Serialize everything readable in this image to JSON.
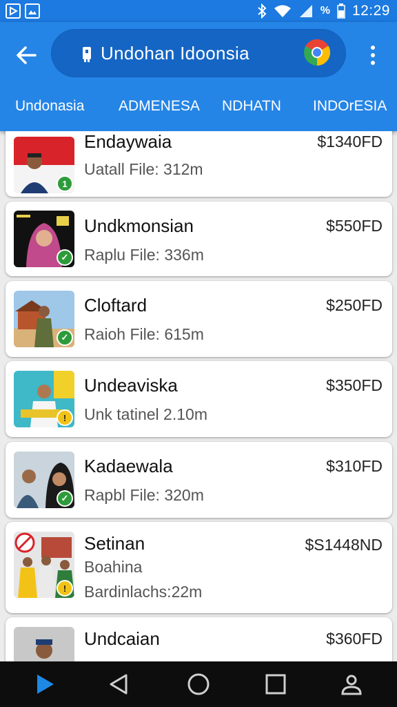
{
  "status_bar": {
    "battery": "%",
    "time": "12:29",
    "icons": [
      "play-store-icon",
      "photo-icon",
      "bluetooth-icon",
      "wifi-icon",
      "signal-icon",
      "battery-icon"
    ]
  },
  "browser": {
    "url": "Undohan Idoonsia",
    "icons": [
      "back-arrow-icon",
      "lock-icon",
      "chrome-icon",
      "more-vert-icon"
    ]
  },
  "tabs": [
    {
      "label": "Undonasia"
    },
    {
      "label": "ADMENESA"
    },
    {
      "label": "NDHATN"
    },
    {
      "label": "INDOrESIA"
    }
  ],
  "listings": [
    {
      "title": "Endaywaia",
      "subtitle": "Uatall File: 312m",
      "price": "$1340FD",
      "badge": "1"
    },
    {
      "title": "Undkmonsian",
      "subtitle": "Raplu File: 336m",
      "price": "$550FD",
      "badge": "✓"
    },
    {
      "title": "Cloftard",
      "subtitle": "Raioh File: 615m",
      "price": "$250FD",
      "badge": "✓"
    },
    {
      "title": "Undeaviska",
      "subtitle": "Unk tatinel 2.10m",
      "price": "$350FD",
      "badge": "!"
    },
    {
      "title": "Kadaewala",
      "subtitle": "Rapbl File: 320m",
      "price": "$310FD",
      "badge": "✓"
    },
    {
      "title": "Setinan",
      "subtitle": "Boahina",
      "subtitle2": "Bardinlachs:22m",
      "price": "$S1448ND",
      "badge": "!"
    },
    {
      "title": "Undcaian",
      "subtitle": "",
      "price": "$360FD",
      "badge": ""
    }
  ],
  "colors": {
    "app_bar": "#2585e6",
    "url_pill": "#1565c4",
    "badge_green": "#2e9b3a",
    "badge_yellow": "#f2c316",
    "nav_play": "#1e88e5"
  },
  "nav_bar": {
    "icons": [
      "play-icon",
      "back-icon",
      "home-icon",
      "recents-icon",
      "person-icon"
    ]
  }
}
